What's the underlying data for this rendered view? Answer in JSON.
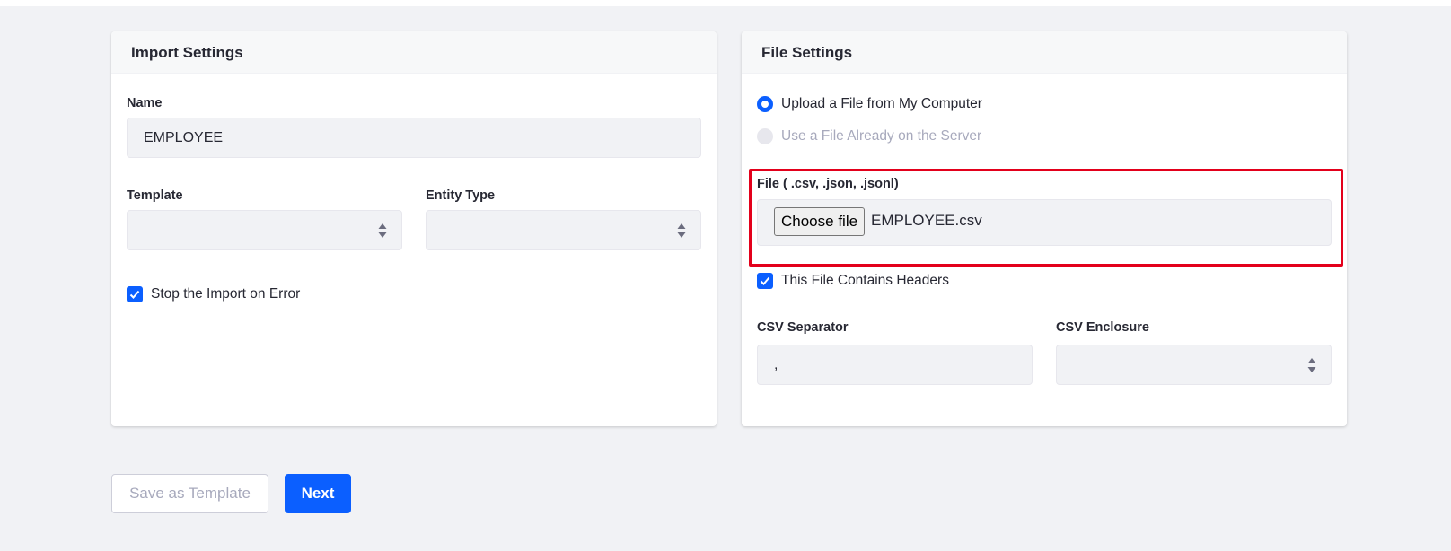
{
  "import_settings": {
    "title": "Import Settings",
    "name_label": "Name",
    "name_value": "EMPLOYEE",
    "template_label": "Template",
    "template_value": "",
    "entity_type_label": "Entity Type",
    "entity_type_value": "",
    "stop_on_error_label": "Stop the Import on Error",
    "stop_on_error_checked": true
  },
  "file_settings": {
    "title": "File Settings",
    "upload_option_label": "Upload a File from My Computer",
    "server_option_label": "Use a File Already on the Server",
    "file_label": "File ( .csv, .json, .jsonl)",
    "choose_file_label": "Choose file",
    "file_name": "EMPLOYEE.csv",
    "headers_label": "This File Contains Headers",
    "headers_checked": true,
    "csv_separator_label": "CSV Separator",
    "csv_separator_value": ",",
    "csv_enclosure_label": "CSV Enclosure",
    "csv_enclosure_value": ""
  },
  "footer": {
    "save_template_label": "Save as Template",
    "next_label": "Next"
  },
  "colors": {
    "primary": "#0b5fff",
    "highlight": "#e3001b",
    "background": "#f1f2f5"
  },
  "icons": {
    "select": "select-arrows-icon",
    "check": "checkmark-icon"
  }
}
